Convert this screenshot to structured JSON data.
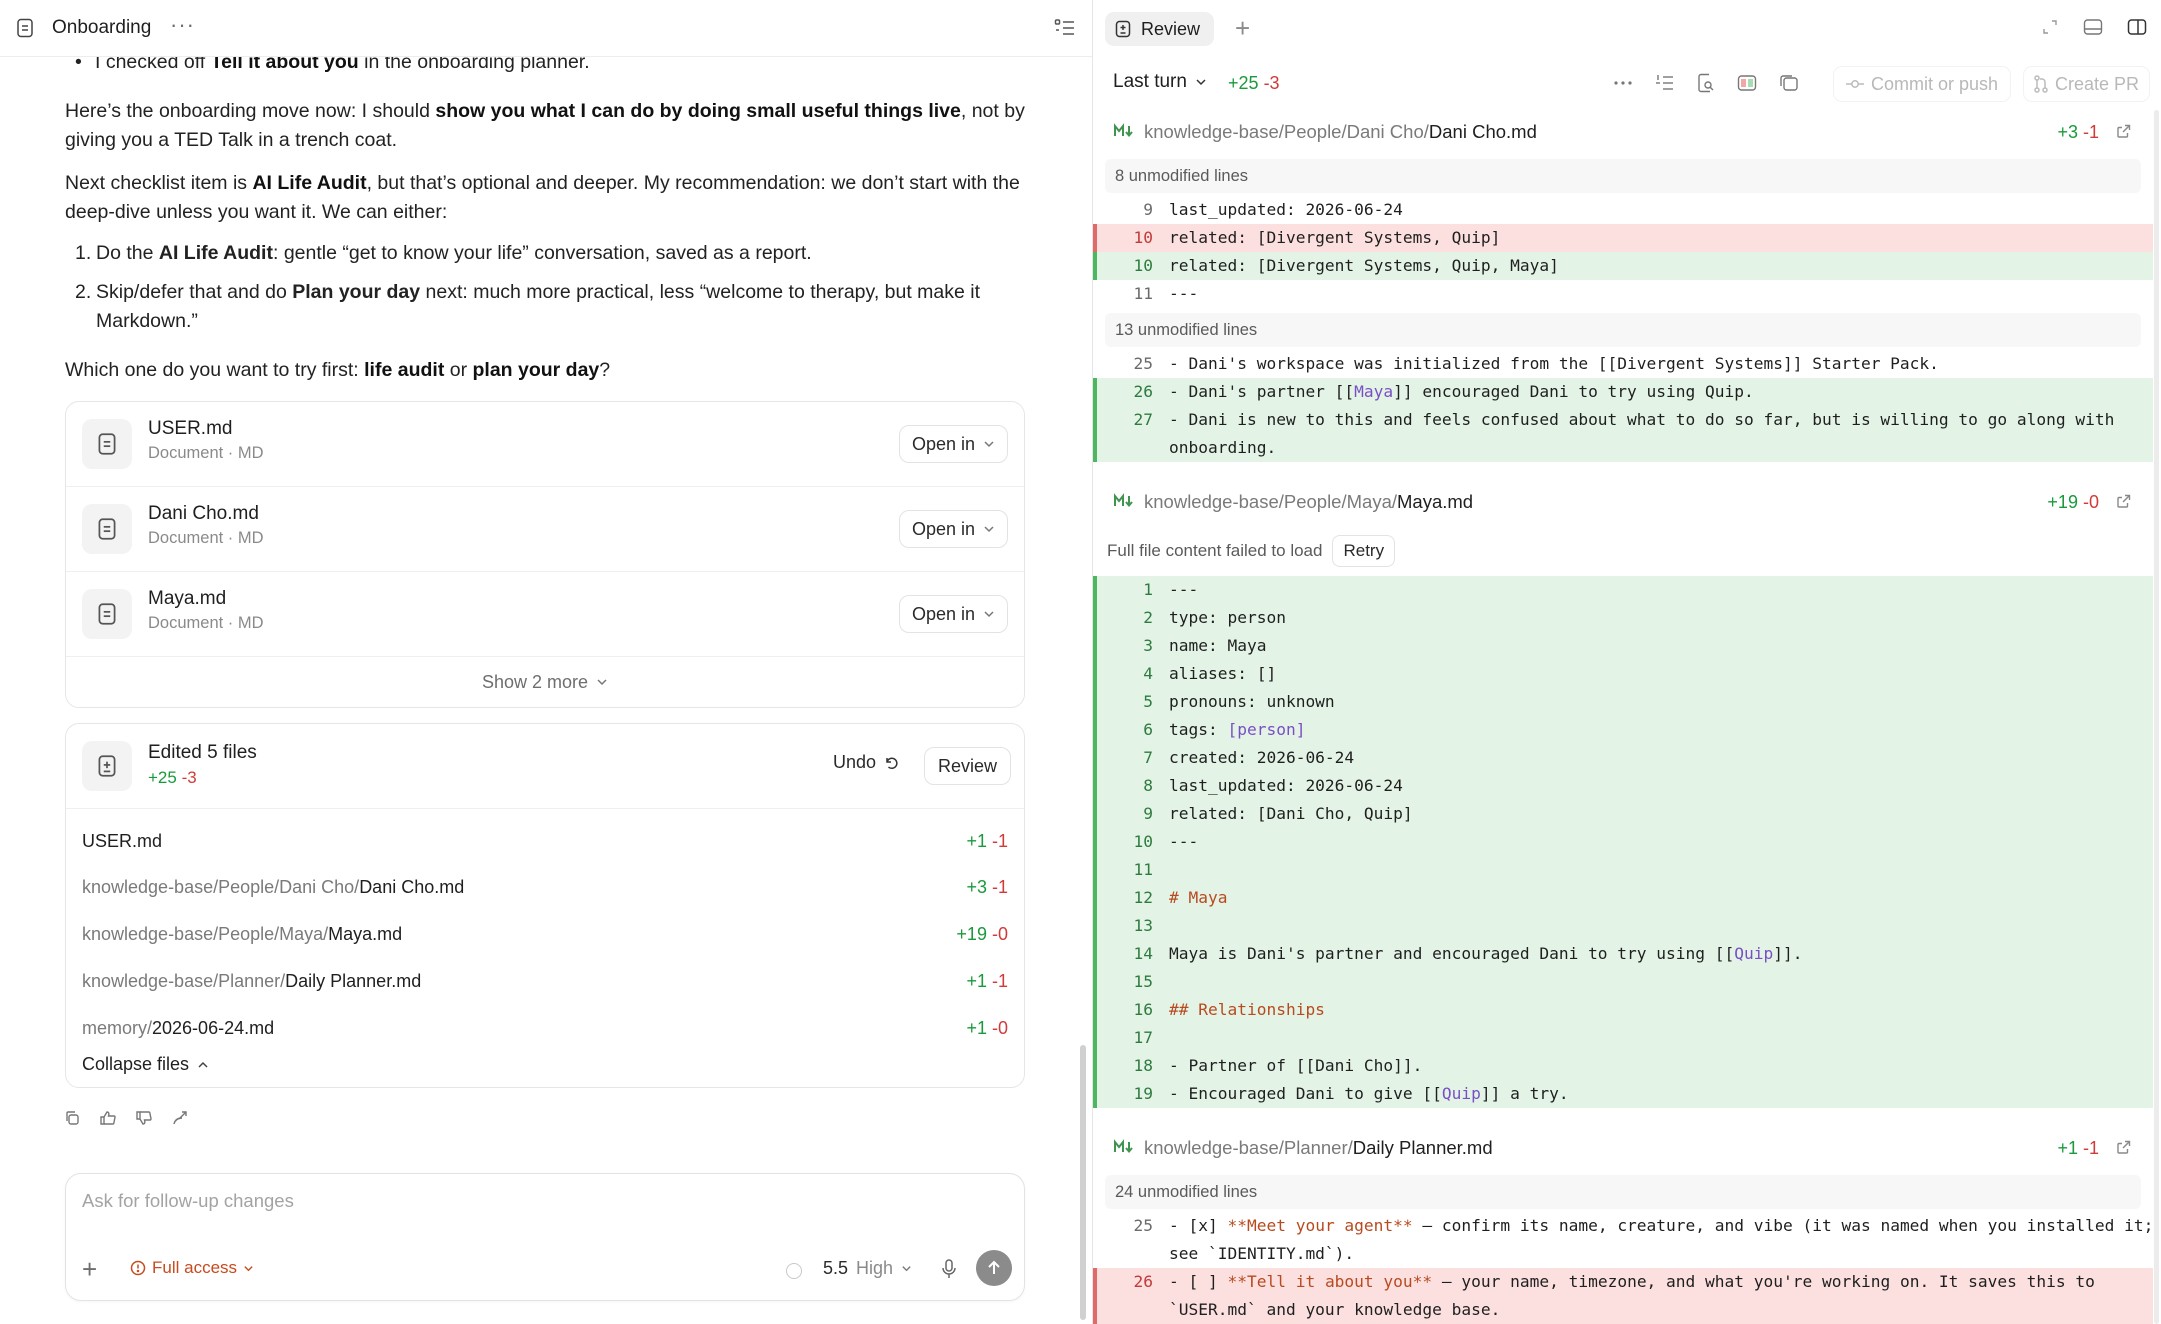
{
  "left_header": {
    "title": "Onboarding",
    "more": "···"
  },
  "chat": {
    "bullet_pre": "I checked off ",
    "bullet_bold": "Tell it about you",
    "bullet_post": " in the onboarding planner.",
    "p1_pre": "Here’s the onboarding move now: I should ",
    "p1_bold": "show you what I can do by doing small useful things live",
    "p1_post": ", not by giving you a TED Talk in a trench coat.",
    "p2_pre": "Next checklist item is ",
    "p2_bold": "AI Life Audit",
    "p2_post": ", but that’s optional and deeper. My recommendation: we don’t start with the deep-dive unless you want it. We can either:",
    "ol1_num": "1.",
    "ol1_pre": "Do the ",
    "ol1_bold": "AI Life Audit",
    "ol1_post": ": gentle “get to know your life” conversation, saved as a report.",
    "ol2_num": "2.",
    "ol2_pre": "Skip/defer that and do ",
    "ol2_bold": "Plan your day",
    "ol2_post": " next: much more practical, less “welcome to therapy, but make it Markdown.”",
    "p3_pre": "Which one do you want to try first: ",
    "p3_bold1": "life audit",
    "p3_mid": " or ",
    "p3_bold2": "plan your day",
    "p3_post": "?"
  },
  "file_cards": [
    {
      "name": "USER.md",
      "sub": "Document · MD",
      "button": "Open in"
    },
    {
      "name": "Dani Cho.md",
      "sub": "Document · MD",
      "button": "Open in"
    },
    {
      "name": "Maya.md",
      "sub": "Document · MD",
      "button": "Open in"
    }
  ],
  "show_more": "Show 2 more",
  "edited": {
    "title": "Edited 5 files",
    "added": "+25",
    "removed": "-3",
    "undo": "Undo",
    "review": "Review",
    "files": [
      {
        "path": "",
        "base": "USER.md",
        "added": "+1",
        "removed": "-1"
      },
      {
        "path": "knowledge-base/People/Dani Cho/",
        "base": "Dani Cho.md",
        "added": "+3",
        "removed": "-1"
      },
      {
        "path": "knowledge-base/People/Maya/",
        "base": "Maya.md",
        "added": "+19",
        "removed": "-0"
      },
      {
        "path": "knowledge-base/Planner/",
        "base": "Daily Planner.md",
        "added": "+1",
        "removed": "-1"
      },
      {
        "path": "memory/",
        "base": "2026-06-24.md",
        "added": "+1",
        "removed": "-0"
      }
    ],
    "collapse": "Collapse files"
  },
  "composer": {
    "placeholder": "Ask for follow-up changes",
    "access": "Full access",
    "model": "5.5",
    "level": "High"
  },
  "review_panel": {
    "tab": "Review",
    "turn": "Last turn",
    "turn_added": "+25",
    "turn_removed": "-3",
    "commit": "Commit or push",
    "create_pr": "Create PR",
    "dani": {
      "path": "knowledge-base/People/Dani Cho/",
      "base": "Dani Cho.md",
      "added": "+3",
      "removed": "-1",
      "unmod1": "8 unmodified lines",
      "unmod2": "13 unmodified lines",
      "lines": [
        {
          "n": "9",
          "code": "last_updated: 2026-06-24"
        },
        {
          "n": "10",
          "code": "related: [Divergent Systems, Quip]"
        },
        {
          "n": "10",
          "code": "related: [Divergent Systems, Quip, Maya]"
        },
        {
          "n": "11",
          "code": "---"
        },
        {
          "n": "25",
          "code": "- Dani's workspace was initialized from the [[Divergent Systems]] Starter Pack."
        },
        {
          "n": "26",
          "code_pre": "- Dani's partner [[",
          "code_link": "Maya",
          "code_post": "]] encouraged Dani to try using Quip."
        },
        {
          "n": "27",
          "code": "- Dani is new to this and feels confused about what to do so far, but is willing to go along with",
          "code2": "onboarding."
        }
      ]
    },
    "maya": {
      "path": "knowledge-base/People/Maya/",
      "base": "Maya.md",
      "added": "+19",
      "removed": "-0",
      "failed": "Full file content failed to load",
      "retry": "Retry",
      "lines": [
        {
          "n": "1",
          "code": "---"
        },
        {
          "n": "2",
          "code": "type: person"
        },
        {
          "n": "3",
          "code": "name: Maya"
        },
        {
          "n": "4",
          "code": "aliases: []"
        },
        {
          "n": "5",
          "code": "pronouns: unknown"
        },
        {
          "n": "6",
          "code_pre": "tags: ",
          "code_link": "[person]",
          "code_post": ""
        },
        {
          "n": "7",
          "code": "created: 2026-06-24"
        },
        {
          "n": "8",
          "code": "last_updated: 2026-06-24"
        },
        {
          "n": "9",
          "code": "related: [Dani Cho, Quip]"
        },
        {
          "n": "10",
          "code": "---"
        },
        {
          "n": "11",
          "code": ""
        },
        {
          "n": "12",
          "code_hdg": "# Maya"
        },
        {
          "n": "13",
          "code": ""
        },
        {
          "n": "14",
          "code_pre": "Maya is Dani's partner and encouraged Dani to try using [[",
          "code_link": "Quip",
          "code_post": "]]."
        },
        {
          "n": "15",
          "code": ""
        },
        {
          "n": "16",
          "code_hdg": "## Relationships"
        },
        {
          "n": "17",
          "code": ""
        },
        {
          "n": "18",
          "code": "- Partner of [[Dani Cho]]."
        },
        {
          "n": "19",
          "code_pre": "- Encouraged Dani to give [[",
          "code_link": "Quip",
          "code_post": "]] a try."
        }
      ]
    },
    "planner": {
      "path": "knowledge-base/Planner/",
      "base": "Daily Planner.md",
      "added": "+1",
      "removed": "-1",
      "unmod": "24 unmodified lines",
      "line25_n": "25",
      "line25_a": "- [x] ",
      "line25_b": "**Meet your agent**",
      "line25_c": " — confirm its name, creature, and vibe (it was named when you installed it;",
      "line25_d": "see `IDENTITY.md`).",
      "line26_n": "26",
      "line26_a": "- [ ] ",
      "line26_b": "**Tell it about you**",
      "line26_c": " — your name, timezone, and what you're working on. It saves this to",
      "line26_d": "`USER.md` and your knowledge base."
    }
  }
}
